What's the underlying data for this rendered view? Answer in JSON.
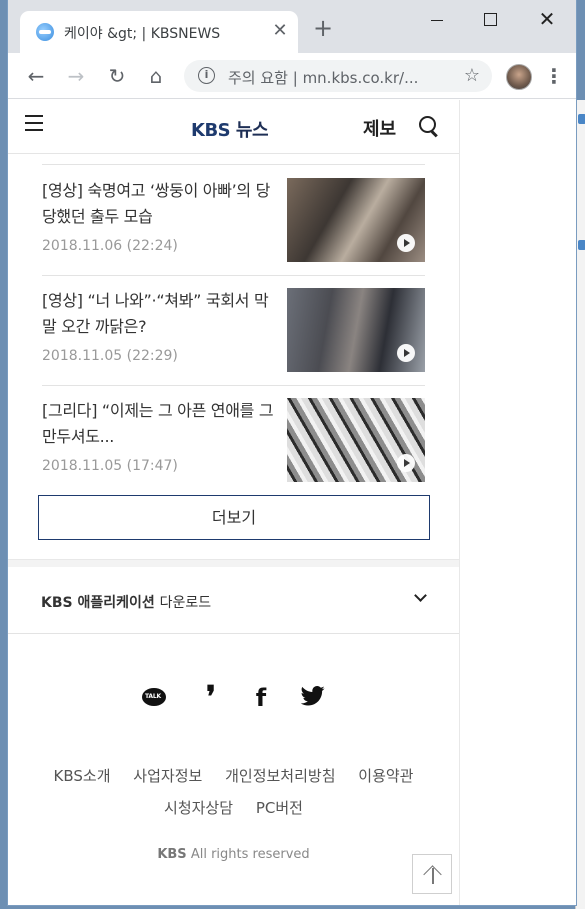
{
  "browser": {
    "tab_title": "케이야 &gt; | KBSNEWS",
    "tab_close": "✕",
    "new_tab": "+",
    "window_close": "✕",
    "address_security": "주의 요함",
    "address_url": "mn.kbs.co.kr/...",
    "icons": [
      "back-icon",
      "forward-icon",
      "reload-icon",
      "home-icon",
      "info-icon",
      "star-icon",
      "kebab-icon"
    ]
  },
  "header": {
    "logo_kbs": "KBS",
    "logo_news": "뉴스",
    "tipoff": "제보"
  },
  "articles": [
    {
      "title": "[영상] 숙명여고 ‘쌍둥이 아빠’의 당당했던 출두 모습",
      "date": "2018.11.06 (22:24)"
    },
    {
      "title": "[영상] “너 나와”·“쳐봐” 국회서 막말 오간 까닭은?",
      "date": "2018.11.05 (22:29)"
    },
    {
      "title": "[그리다] “이제는 그 아픈 연애를 그만두셔도...",
      "date": "2018.11.05 (17:47)"
    }
  ],
  "more_button": "더보기",
  "app_download": {
    "brand": "KBS 애플리케이션",
    "action": "다운로드"
  },
  "social": [
    "kakaotalk-icon",
    "kakaostory-icon",
    "facebook-icon",
    "twitter-icon"
  ],
  "footer": {
    "links": [
      "KBS소개",
      "사업자정보",
      "개인정보처리방침",
      "이용약관",
      "시청자상담",
      "PC버전"
    ],
    "copyright_brand": "KBS",
    "copyright_text": "All rights reserved"
  },
  "colors": {
    "brand_navy": "#1e3a6e",
    "date_gray": "#999999",
    "tab_strip": "#dee1e6"
  }
}
